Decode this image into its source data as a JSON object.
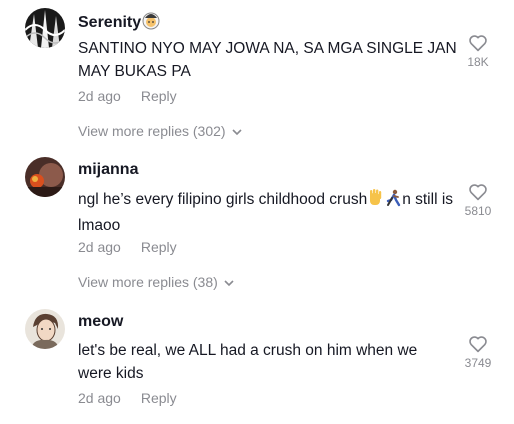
{
  "comments": [
    {
      "username": "Serenity",
      "username_emoji": "woman-with-veil-emoji",
      "text": "SANTINO NYO MAY JOWA NA, SA MGA SINGLE JAN MAY BUKAS PA",
      "time": "2d ago",
      "reply_label": "Reply",
      "likes": "18K",
      "view_more": "View more replies (302)"
    },
    {
      "username": "mijanna",
      "text_before": "ngl he’s every filipino girls childhood crush",
      "text_after": "n still is lmaoo",
      "inline_emojis": [
        "raised-hand-emoji",
        "running-person-emoji"
      ],
      "time": "2d ago",
      "reply_label": "Reply",
      "likes": "5810",
      "view_more": "View more replies (38)"
    },
    {
      "username": "meow",
      "text": "let's be real, we ALL had a crush on him when we were kids",
      "time": "2d ago",
      "reply_label": "Reply",
      "likes": "3749"
    }
  ],
  "icons": {
    "like": "heart-outline-icon",
    "expand": "chevron-down-icon"
  },
  "colors": {
    "text": "#161823",
    "muted": "#8a8b91"
  }
}
